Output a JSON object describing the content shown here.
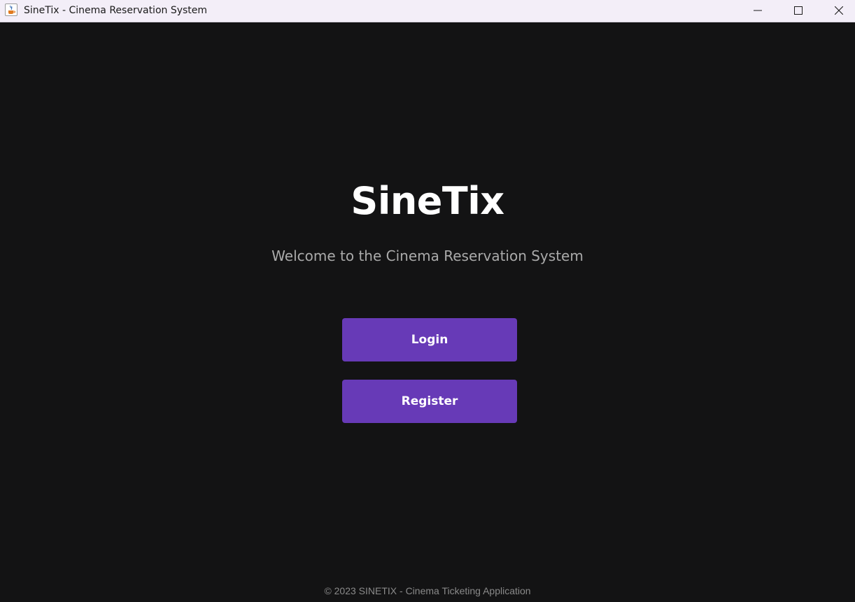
{
  "window": {
    "title": "SineTix - Cinema Reservation System",
    "app_icon": "java-cup-icon",
    "controls": {
      "minimize_icon": "minimize-icon",
      "maximize_icon": "maximize-icon",
      "close_icon": "close-icon"
    }
  },
  "main": {
    "brand": "SineTix",
    "tagline": "Welcome to the Cinema Reservation System",
    "login_label": "Login",
    "register_label": "Register",
    "footer": "© 2023 SINETIX - Cinema Ticketing Application"
  },
  "colors": {
    "background": "#131314",
    "button": "#673ab7",
    "brand_text": "#ffffff",
    "tagline_text": "#aaaaaa",
    "footer_text": "#8a8a8a"
  }
}
